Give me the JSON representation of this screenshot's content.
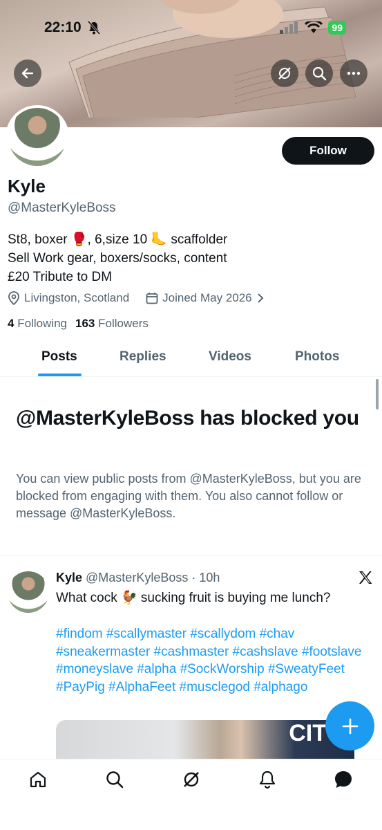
{
  "status_bar": {
    "time": "22:10",
    "battery": "99"
  },
  "profile": {
    "name": "Kyle",
    "handle": "@MasterKyleBoss",
    "follow_label": "Follow",
    "bio_lines": [
      "St8, boxer 🥊, 6,size 10 🦶 scaffolder",
      "Sell Work gear, boxers/socks, content",
      "£20 Tribute to DM"
    ],
    "location": "Livingston, Scotland",
    "joined": "Joined May 2026",
    "following_count": "4",
    "following_label": "Following",
    "followers_count": "163",
    "followers_label": "Followers"
  },
  "tabs": [
    "Posts",
    "Replies",
    "Videos",
    "Photos"
  ],
  "blocked": {
    "title": "@MasterKyleBoss has blocked you",
    "description": "You can view public posts from @MasterKyleBoss, but you are blocked from engaging with them. You also cannot follow or message @MasterKyleBoss."
  },
  "tweet": {
    "author": "Kyle",
    "handle": "@MasterKyleBoss",
    "separator": "·",
    "time": "10h",
    "text": "What cock 🐓 sucking fruit is buying me lunch?",
    "hashtags": "#findom #scallymaster #scallydom #chav #sneakermaster #cashmaster #cashslave #footslave #moneyslave #alpha #SockWorship #SweatyFeet #PayPig #AlphaFeet #musclegod #alphago",
    "media_label": "CIT"
  },
  "icons": {
    "back": "back-arrow-icon",
    "grok": "grok-icon",
    "search": "search-icon",
    "more": "more-icon",
    "location": "location-pin-icon",
    "calendar": "calendar-icon",
    "x_logo": "x-logo-icon",
    "compose": "plus-icon",
    "nav": [
      "home-icon",
      "search-icon",
      "grok-icon",
      "notifications-icon",
      "messages-icon"
    ]
  },
  "colors": {
    "accent": "#1d9bf0",
    "text": "#0f1419",
    "secondary": "#536471",
    "battery": "#34c759"
  }
}
